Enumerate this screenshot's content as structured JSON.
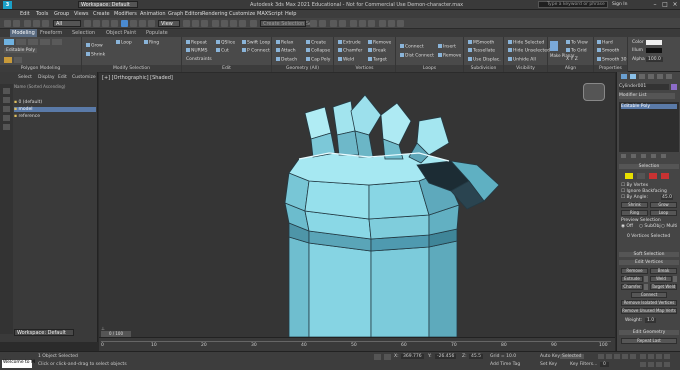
{
  "title": {
    "app_title": "Autodesk 3ds Max 2021 Educational - Not for Commercial Use   Demon-character.max",
    "workspace": "Workspace: Default",
    "search_placeholder": "Type a keyword or phrase",
    "sign_in": "Sign In"
  },
  "menu": [
    "Edit",
    "Tools",
    "Group",
    "Views",
    "Create",
    "Modifiers",
    "Animation",
    "Graph Editors",
    "Rendering",
    "Customize",
    "MAXScript",
    "Help"
  ],
  "toolbar": {
    "selection_filter": "All",
    "view_dropdown": "View",
    "selection_set": "Create Selection Se"
  },
  "ribbon_tabs": [
    "Modeling",
    "Freeform",
    "Selection",
    "Object Paint",
    "Populate"
  ],
  "ribbon": {
    "poly_modeling": {
      "items": [
        "Editable Poly",
        "Polygon Modeling"
      ],
      "caption": "Polygon Modeling"
    },
    "modify_selection": {
      "items": [
        "Grow",
        "Shrink",
        "Loop",
        "Ring"
      ],
      "caption": "Modify Selection"
    },
    "edit": {
      "items": [
        "Repeat",
        "QSlice",
        "Swift Loop",
        "NURMS",
        "Cut",
        "P Connect",
        "Constraints"
      ],
      "caption": "Edit"
    },
    "geometry": {
      "items": [
        "Relax",
        "Create",
        "Attach",
        "Collapse",
        "Detach",
        "Cap Poly"
      ],
      "caption": "Geometry (All)"
    },
    "vertices": {
      "items": [
        "Extrude",
        "Remove",
        "Chamfer",
        "Break",
        "Weld",
        "Target"
      ],
      "caption": "Vertices"
    },
    "loops": {
      "items": [
        "Connect",
        "Insert",
        "Dist Connect",
        "Remove"
      ],
      "caption": "Loops"
    },
    "subdivision": {
      "items": [
        "MSmooth",
        "Tessellate",
        "Use Displac."
      ],
      "caption": "Subdivision"
    },
    "visibility": {
      "items": [
        "Hide Selected",
        "Hide Unselected",
        "Unhide All"
      ],
      "caption": "Visibility"
    },
    "align": {
      "items": [
        "To View",
        "To Grid",
        "X Y Z",
        "Make Planar"
      ],
      "caption": "Align"
    },
    "properties": {
      "items": [
        "Hard",
        "Smooth",
        "Smooth 30"
      ],
      "caption": "Properties"
    },
    "colors": {
      "items": [
        "Color",
        "Illum",
        "Alpha"
      ],
      "alpha_value": "100.0"
    }
  },
  "scene_explorer": {
    "tabs": [
      "Select",
      "Display",
      "Edit",
      "Customize"
    ],
    "column_header": "Name (Sorted Ascending)",
    "items": [
      "0 (default)",
      "model",
      "reference"
    ],
    "workspace": "Workspace: Default"
  },
  "viewport": {
    "label": "[+] [Orthographic] [Shaded]"
  },
  "command_panel": {
    "object_name": "Cylinder001",
    "modifier_list": "Modifier List",
    "stack_item": "Editable Poly",
    "selection_rollout": "Selection",
    "by_vertex": "By Vertex",
    "ignore_backfacing": "Ignore Backfacing",
    "by_angle": "By Angle:",
    "angle_value": "45.0",
    "shrink": "Shrink",
    "grow": "Grow",
    "ring": "Ring",
    "loop": "Loop",
    "preview_selection": "Preview Selection",
    "preview_options": [
      "Off",
      "SubObj",
      "Multi"
    ],
    "selected_count": "0 Vertices Selected",
    "soft_selection": "Soft Selection",
    "edit_vertices": "Edit Vertices",
    "remove": "Remove",
    "break_btn": "Break",
    "extrude": "Extrude",
    "weld": "Weld",
    "chamfer": "Chamfer",
    "target_weld": "Target Weld",
    "connect": "Connect",
    "remove_isolated": "Remove Isolated Vertices",
    "remove_unused": "Remove Unused Map Verts",
    "weight_label": "Weight:",
    "weight_value": "1.0",
    "edit_geometry": "Edit Geometry",
    "repeat_last": "Repeat Last"
  },
  "timeline": {
    "frame": "0 / 100",
    "ticks": [
      "0",
      "10",
      "20",
      "30",
      "40",
      "50",
      "60",
      "70",
      "80",
      "90",
      "100"
    ]
  },
  "status": {
    "maxscript": "Welcome to M",
    "selected": "1 Object Selected",
    "hint": "Click or click-and-drag to select objects",
    "x_label": "X:",
    "x": "369.776",
    "y_label": "Y:",
    "y": "-26.456",
    "z_label": "Z:",
    "z": "45.5",
    "grid": "Grid = 10.0",
    "add_time_tag": "Add Time Tag",
    "autokey": "Auto Key",
    "selected_dd": "Selected",
    "setkey": "Set Key",
    "key_filters": "Key Filters...",
    "frame_box": "0"
  },
  "colors": {
    "accent": "#5a7aa8",
    "mesh_light": "#86d8e6",
    "mesh_dark": "#1c2c34",
    "cyan_ui": "#1aa0c8"
  }
}
